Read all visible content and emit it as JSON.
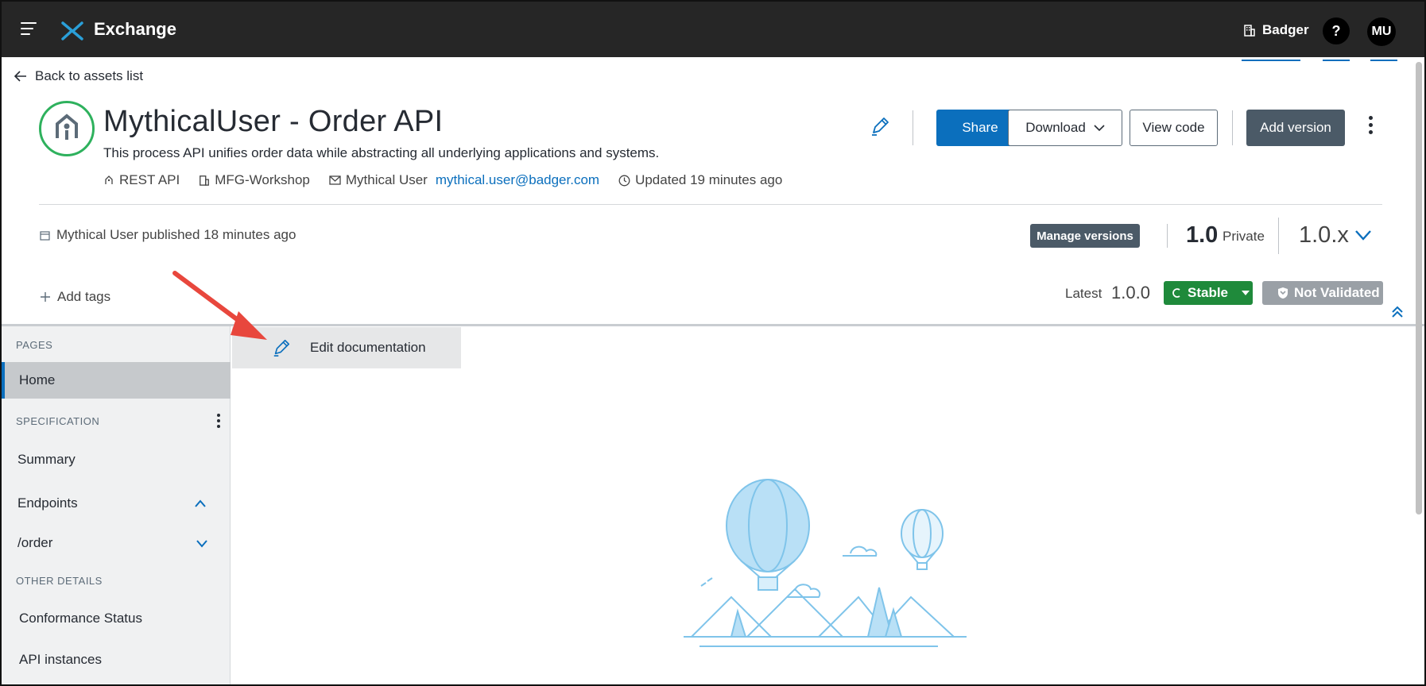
{
  "topbar": {
    "app_title": "Exchange",
    "org_name": "Badger",
    "help_label": "?",
    "user_initials": "MU"
  },
  "header": {
    "back_label": "Back to assets list",
    "title": "MythicalUser - Order API",
    "description": "This process API unifies order data while abstracting all underlying applications and systems.",
    "meta": {
      "type": "REST API",
      "business_group": "MFG-Workshop",
      "owner": "Mythical User",
      "owner_email": "mythical.user@badger.com",
      "updated": "Updated 19 minutes ago"
    },
    "actions": {
      "share": "Share",
      "download": "Download",
      "view_code": "View code",
      "add_version": "Add version"
    },
    "published": "Mythical User published 18 minutes ago",
    "manage_versions": "Manage versions",
    "version": "1.0",
    "visibility": "Private",
    "selected_version": "1.0.x",
    "add_tags": "Add tags",
    "latest_label": "Latest",
    "latest_version": "1.0.0",
    "stable_label": "Stable",
    "validation_label": "Not Validated"
  },
  "sidebar": {
    "pages_heading": "PAGES",
    "home": "Home",
    "spec_heading": "SPECIFICATION",
    "summary": "Summary",
    "endpoints": "Endpoints",
    "order_endpoint": "/order",
    "other_heading": "OTHER DETAILS",
    "conformance": "Conformance Status",
    "api_instances": "API instances"
  },
  "content": {
    "edit_documentation": "Edit documentation"
  },
  "colors": {
    "topbar": "#262626",
    "primary": "#0b6fbd",
    "stable": "#1f8a3b",
    "not_validated": "#9aa0a6",
    "annotation_arrow": "#e8473d"
  },
  "icons": [
    "hamburger-icon",
    "exchange-logo-icon",
    "building-icon",
    "back-arrow-icon",
    "api-icon",
    "pencil-icon",
    "chevron-down-icon",
    "kebab-icon",
    "calendar-icon",
    "plus-icon",
    "stable-icon",
    "shield-icon",
    "double-chevron-up-icon",
    "chevron-up-icon",
    "balloon-illustration"
  ]
}
